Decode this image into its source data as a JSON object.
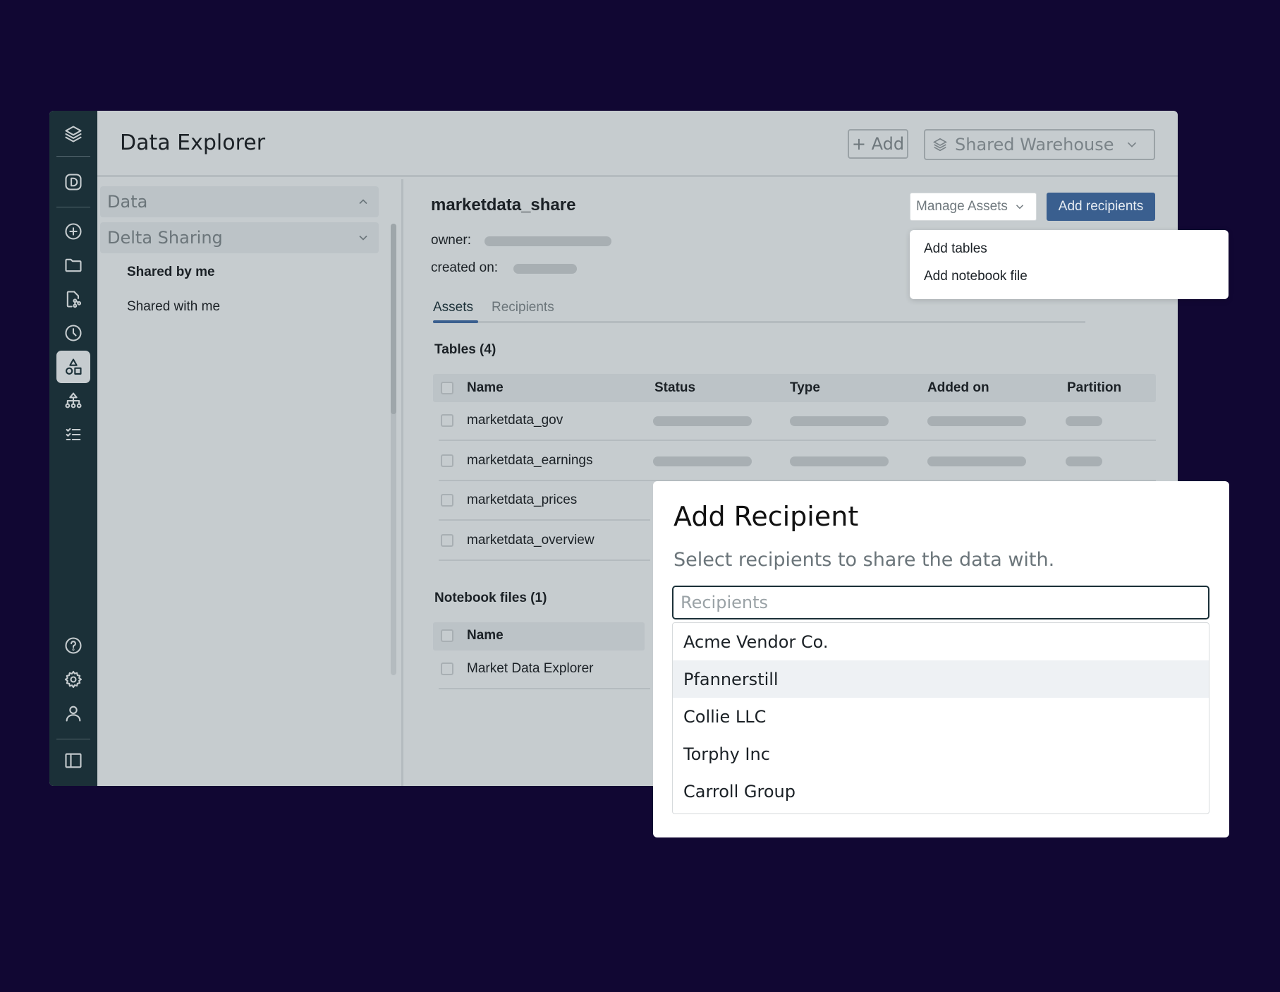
{
  "app": {
    "title": "Data Explorer"
  },
  "header": {
    "add_label": "+ Add",
    "warehouse_label": "Shared Warehouse"
  },
  "left_nav": {
    "sections": [
      {
        "label": "Data"
      },
      {
        "label": "Delta Sharing"
      }
    ],
    "items": [
      {
        "label": "Shared by me",
        "active": true
      },
      {
        "label": "Shared with me"
      }
    ]
  },
  "share": {
    "name": "marketdata_share",
    "owner_label": "owner:",
    "created_label": "created on:",
    "manage_label": "Manage Assets",
    "add_recipients_label": "Add recipients"
  },
  "manage_menu": {
    "items": [
      "Add tables",
      "Add notebook file"
    ]
  },
  "tabs": [
    {
      "label": "Assets",
      "active": true
    },
    {
      "label": "Recipients"
    }
  ],
  "tables": {
    "heading": "Tables (4)",
    "columns": [
      "Name",
      "Status",
      "Type",
      "Added on",
      "Partition"
    ],
    "rows": [
      "marketdata_gov",
      "marketdata_earnings",
      "marketdata_prices",
      "marketdata_overview"
    ]
  },
  "notebooks": {
    "heading": "Notebook files (1)",
    "columns": [
      "Name"
    ],
    "rows": [
      "Market Data Explorer"
    ]
  },
  "modal": {
    "title": "Add Recipient",
    "subtitle": "Select recipients to share the data with.",
    "input_placeholder": "Recipients",
    "options": [
      "Acme Vendor Co.",
      "Pfannerstill",
      "Collie LLC",
      "Torphy Inc",
      "Carroll Group"
    ],
    "highlighted_option": "Pfannerstill"
  },
  "colors": {
    "background": "#110733",
    "rail": "#1b3038",
    "primary_button": "#3a5f8f"
  },
  "rail_icons": [
    "layers-icon",
    "d-badge-icon",
    "plus-circle-icon",
    "folder-icon",
    "file-branch-icon",
    "clock-icon",
    "shapes-icon",
    "hierarchy-icon",
    "checklist-icon",
    "help-icon",
    "gear-icon",
    "user-icon",
    "sidebar-toggle-icon"
  ]
}
